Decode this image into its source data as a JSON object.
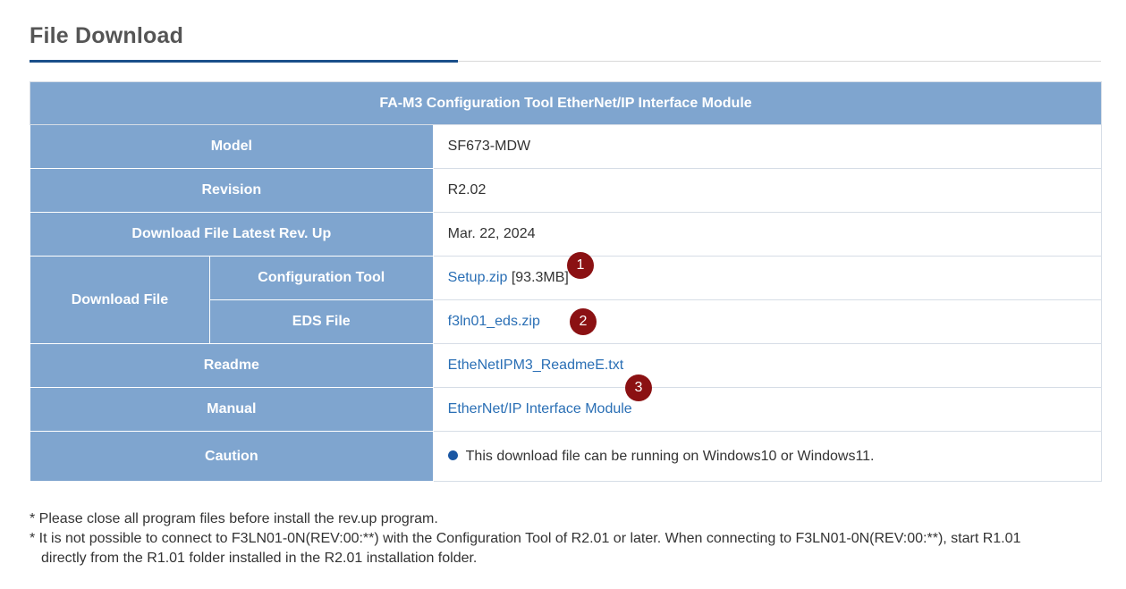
{
  "section": {
    "title": "File Download"
  },
  "table": {
    "heading": "FA-M3 Configuration Tool EtherNet/IP Interface Module",
    "model_label": "Model",
    "model_value": "SF673-MDW",
    "revision_label": "Revision",
    "revision_value": "R2.02",
    "latest_label": "Download File Latest Rev. Up",
    "latest_value": "Mar. 22, 2024",
    "download_label": "Download File",
    "config_label": "Configuration Tool",
    "config_link": "Setup.zip",
    "config_size": "[93.3MB]",
    "eds_label": "EDS File",
    "eds_link": "f3ln01_eds.zip",
    "readme_label": "Readme",
    "readme_link": "EtheNetIPM3_ReadmeE.txt",
    "manual_label": "Manual",
    "manual_link": "EtherNet/IP Interface Module",
    "caution_label": "Caution",
    "caution_text": "This download file can be running on Windows10 or Windows11."
  },
  "badges": [
    "1",
    "2",
    "3"
  ],
  "notes": {
    "line1": "* Please close all program files before install the rev.up program.",
    "line2": "* It is not possible to connect to F3LN01-0N(REV:00:**) with the Configuration Tool of R2.01 or later. When connecting to F3LN01-0N(REV:00:**), start R1.01",
    "line3": "directly from the R1.01 folder installed in the R2.01 installation folder."
  },
  "colors": {
    "header_bg": "#7fa5cf",
    "link": "#2a6fb5",
    "accent": "#1a4f8a",
    "badge": "#8b1113"
  }
}
